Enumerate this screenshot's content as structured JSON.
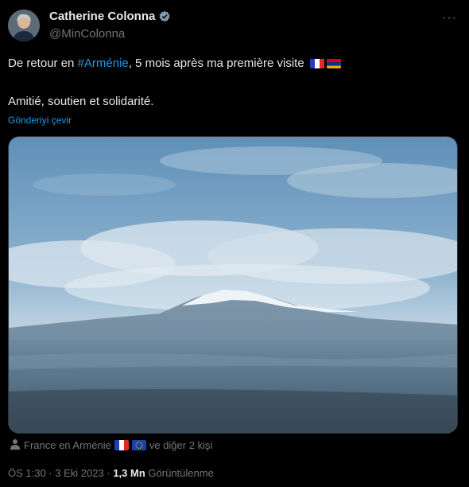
{
  "tweet": {
    "author_name": "Catherine Colonna",
    "handle": "@MinColonna",
    "more_label": "···",
    "text_before": "De retour en ",
    "hashtag": "#Arménie",
    "text_after": ", 5 mois après ma première visite",
    "line2": "Amitié, soutien et solidarité.",
    "translate_label": "Gönderiyi çevir",
    "tagged_account": "France en Arménie",
    "tagged_suffix": "ve diğer 2 kişi",
    "time": "ÖS 1:30",
    "date": "3 Eki 2023",
    "separator": "·",
    "views_count": "1,3 Mn",
    "views_label": "Görüntülenme"
  },
  "icons": [
    "verified-badge-icon",
    "more-icon",
    "france-flag-icon",
    "armenia-flag-icon",
    "eu-flag-icon",
    "person-icon"
  ],
  "colors": {
    "background": "#000000",
    "text": "#e7e9ea",
    "muted": "#71767b",
    "link": "#1d9bf0"
  }
}
